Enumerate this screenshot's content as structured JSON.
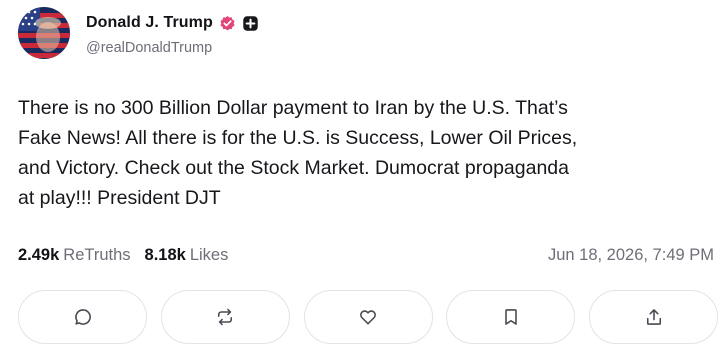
{
  "author": {
    "display_name": "Donald J. Trump",
    "handle": "@realDonaldTrump",
    "verified_badge_icon": "verified-check-icon",
    "extra_badge_icon": "plus-badge-icon",
    "verified_color": "#e0457b"
  },
  "post": {
    "lines": [
      "There is no 300 Billion Dollar payment to Iran by the U.S. That’s",
      "Fake News! All there is for the U.S. is Success, Lower Oil Prices,",
      "and Victory. Check out the Stock Market. Dumocrat propaganda",
      "at play!!! President DJT"
    ]
  },
  "stats": {
    "retruths_count": "2.49k",
    "retruths_label": "ReTruths",
    "likes_count": "8.18k",
    "likes_label": "Likes"
  },
  "timestamp": "Jun 18, 2026, 7:49 PM",
  "actions": [
    {
      "name": "reply",
      "icon": "comment-icon"
    },
    {
      "name": "retruth",
      "icon": "repost-icon"
    },
    {
      "name": "like",
      "icon": "heart-icon"
    },
    {
      "name": "bookmark",
      "icon": "bookmark-icon"
    },
    {
      "name": "share",
      "icon": "share-icon"
    }
  ]
}
